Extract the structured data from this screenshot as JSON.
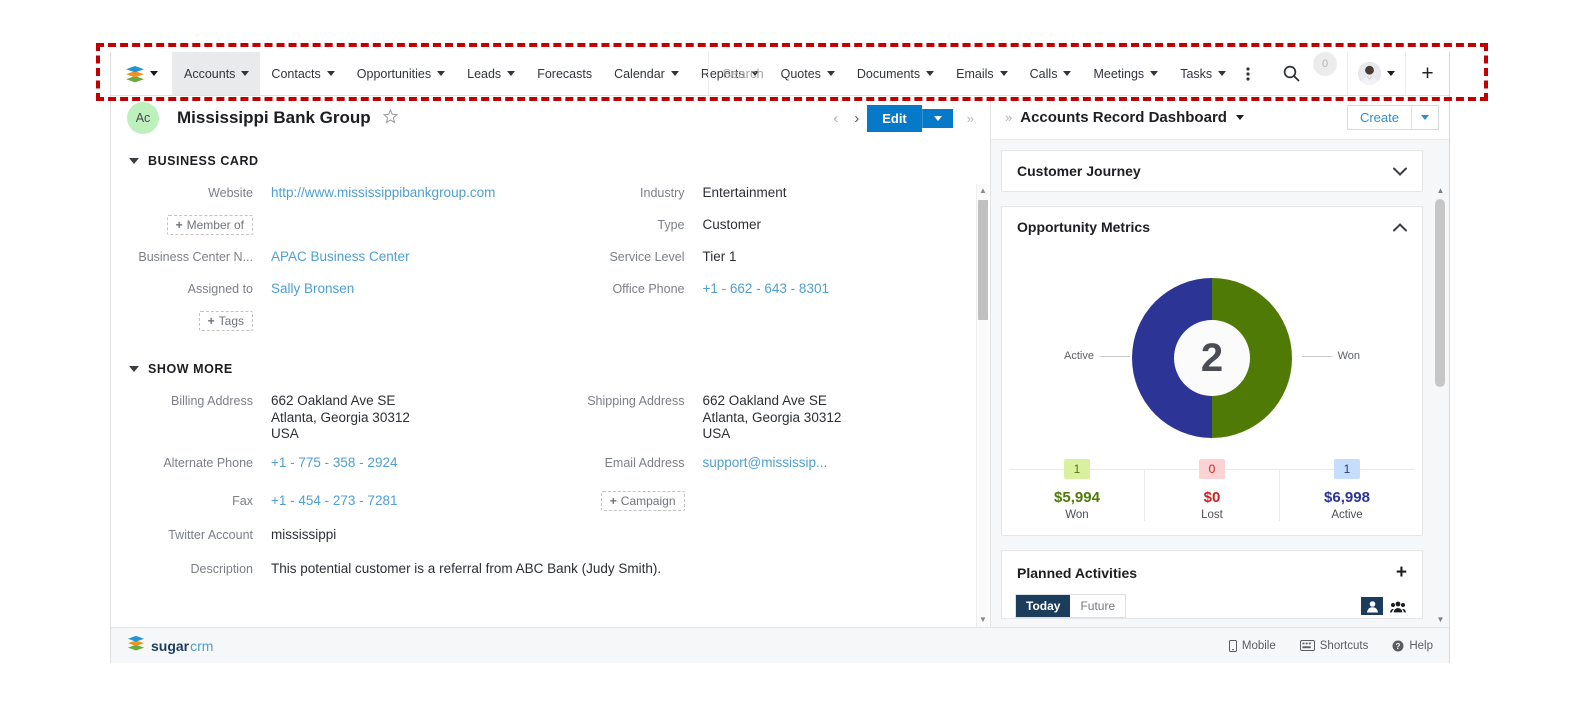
{
  "navbar": {
    "logo_icon": "sugarcrm-stack-logo",
    "items": [
      {
        "label": "Accounts",
        "has_caret": true,
        "active": true
      },
      {
        "label": "Contacts",
        "has_caret": true,
        "active": false
      },
      {
        "label": "Opportunities",
        "has_caret": true,
        "active": false
      },
      {
        "label": "Leads",
        "has_caret": true,
        "active": false
      },
      {
        "label": "Forecasts",
        "has_caret": false,
        "active": false
      },
      {
        "label": "Calendar",
        "has_caret": true,
        "active": false
      },
      {
        "label": "Reports",
        "has_caret": true,
        "active": false
      },
      {
        "label": "Quotes",
        "has_caret": true,
        "active": false
      },
      {
        "label": "Documents",
        "has_caret": true,
        "active": false
      },
      {
        "label": "Emails",
        "has_caret": true,
        "active": false
      },
      {
        "label": "Calls",
        "has_caret": true,
        "active": false
      },
      {
        "label": "Meetings",
        "has_caret": true,
        "active": false
      },
      {
        "label": "Tasks",
        "has_caret": true,
        "active": false
      }
    ],
    "more_icon": "kebab-menu-icon",
    "search_placeholder": "Search",
    "search_value": "",
    "search_icon": "search-icon",
    "notification_count": "0",
    "avatar_icon": "user-avatar",
    "plus_icon": "plus-icon"
  },
  "record": {
    "badge": "Ac",
    "title": "Mississippi Bank Group",
    "favorite_icon": "star-outline-icon",
    "prev_icon": "chevron-left-icon",
    "next_icon": "chevron-right-icon",
    "edit_label": "Edit",
    "collapse_icon": "double-chevron-right-icon",
    "sections": [
      {
        "title": "BUSINESS CARD",
        "collapsed": false,
        "left_fields": [
          {
            "label": "Website",
            "value": "http://www.mississippibankgroup.com",
            "type": "link"
          },
          {
            "label": "",
            "value": "Member of",
            "type": "pill"
          },
          {
            "label": "Business Center N...",
            "value": "APAC Business Center",
            "type": "link"
          },
          {
            "label": "Assigned to",
            "value": "Sally Bronsen",
            "type": "link"
          },
          {
            "label": "",
            "value": "Tags",
            "type": "pill"
          }
        ],
        "right_fields": [
          {
            "label": "Industry",
            "value": "Entertainment",
            "type": "text"
          },
          {
            "label": "Type",
            "value": "Customer",
            "type": "text"
          },
          {
            "label": "Service Level",
            "value": "Tier 1",
            "type": "text"
          },
          {
            "label": "Office Phone",
            "value": "+1 - 662 - 643 - 8301",
            "type": "link"
          }
        ]
      },
      {
        "title": "SHOW MORE",
        "collapsed": false,
        "left_fields": [
          {
            "label": "Billing Address",
            "value": "662 Oakland Ave SE\nAtlanta, Georgia 30312\nUSA",
            "type": "text"
          },
          {
            "label": "Alternate Phone",
            "value": "+1 - 775 - 358 - 2924",
            "type": "link"
          },
          {
            "label": "Fax",
            "value": "+1 - 454 - 273 - 7281",
            "type": "link"
          },
          {
            "label": "Twitter Account",
            "value": "mississippi",
            "type": "text"
          },
          {
            "label": "Description",
            "value": "This potential customer is a referral from ABC Bank (Judy Smith).",
            "type": "text"
          }
        ],
        "right_fields": [
          {
            "label": "Shipping Address",
            "value": "662 Oakland Ave SE\nAtlanta, Georgia 30312\nUSA",
            "type": "text"
          },
          {
            "label": "Email Address",
            "value": "support@mississip...",
            "type": "link"
          },
          {
            "label": "",
            "value": "Campaign",
            "type": "pill"
          }
        ]
      }
    ]
  },
  "dashboard": {
    "title": "Accounts Record Dashboard",
    "create_label": "Create",
    "panels": {
      "customer_journey": {
        "title": "Customer Journey",
        "collapsed": true,
        "toggle_icon": "chevron-down-icon"
      },
      "opportunity_metrics": {
        "title": "Opportunity Metrics",
        "collapsed": false,
        "toggle_icon": "chevron-up-icon"
      },
      "planned_activities": {
        "title": "Planned Activities",
        "add_icon": "plus-icon",
        "tabs": [
          {
            "label": "Today",
            "active": true
          },
          {
            "label": "Future",
            "active": false
          }
        ],
        "view_icons": [
          {
            "name": "single-user-icon",
            "selected": true
          },
          {
            "name": "group-users-icon",
            "selected": false
          }
        ]
      }
    },
    "chart_data": {
      "type": "pie",
      "title": "Opportunity Metrics",
      "center_value": "2",
      "slices": [
        {
          "label": "Active",
          "value": 1,
          "percent": 50,
          "color": "#2c3595"
        },
        {
          "label": "Won",
          "value": 1,
          "percent": 50,
          "color": "#4f7a06"
        }
      ],
      "legend_position": "callout-lines",
      "metrics": [
        {
          "count": "1",
          "amount": "$5,994",
          "caption": "Won",
          "chip_bg": "#d8f0a0",
          "chip_fg": "#4f7a06",
          "amount_color": "#4f7a06"
        },
        {
          "count": "0",
          "amount": "$0",
          "caption": "Lost",
          "chip_bg": "#fbd3d3",
          "chip_fg": "#cc2222",
          "amount_color": "#cc2222"
        },
        {
          "count": "1",
          "amount": "$6,998",
          "caption": "Active",
          "chip_bg": "#c6ddfb",
          "chip_fg": "#2c3595",
          "amount_color": "#2c3595"
        }
      ]
    }
  },
  "footer": {
    "logo_part1": "sugar",
    "logo_part2": "crm",
    "links": [
      {
        "label": "Mobile",
        "icon": "mobile-icon"
      },
      {
        "label": "Shortcuts",
        "icon": "keyboard-icon"
      },
      {
        "label": "Help",
        "icon": "help-circle-icon"
      }
    ]
  },
  "annotation": {
    "shape": "dashed-rectangle",
    "color": "#c00000",
    "target": "navigation-bar"
  }
}
